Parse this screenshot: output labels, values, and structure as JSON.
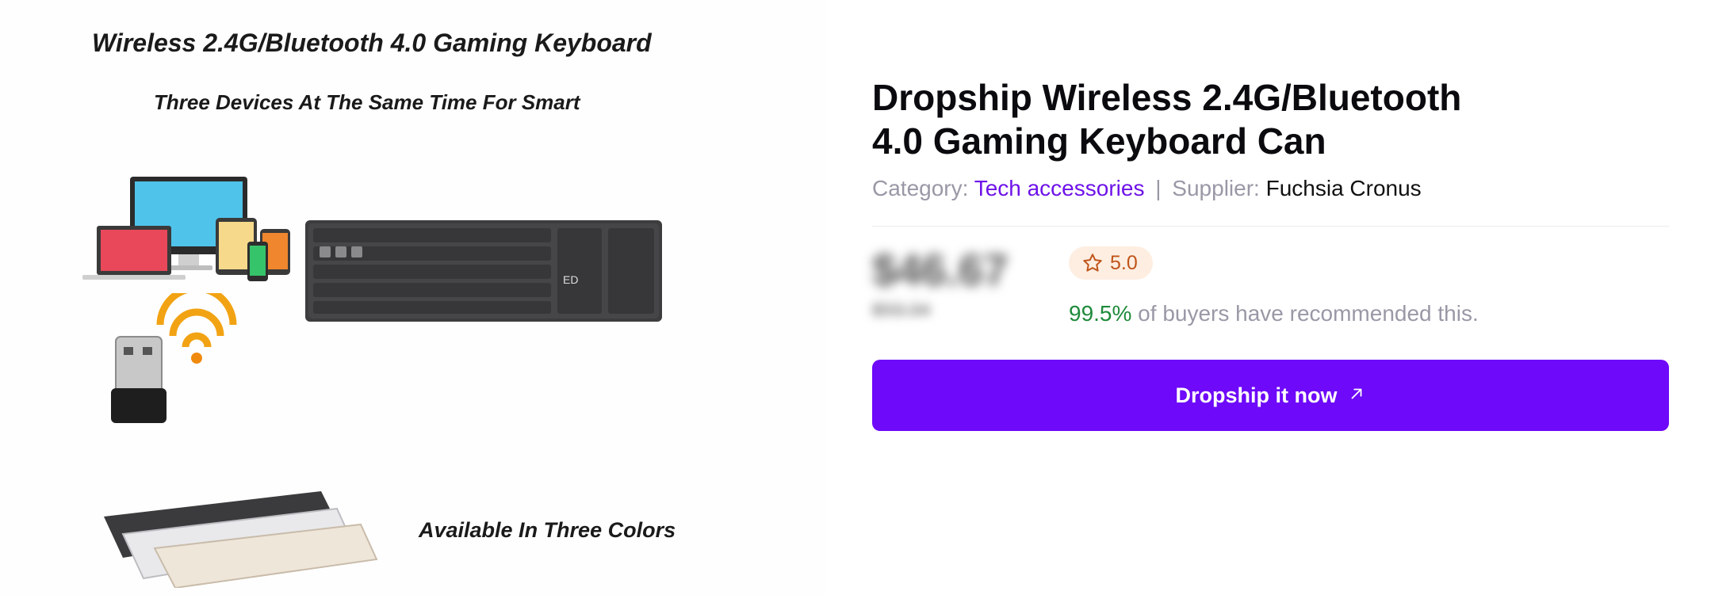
{
  "product_image": {
    "headline": "Wireless 2.4G/Bluetooth 4.0 Gaming Keyboard",
    "subheadline": "Three Devices At The Same Time For Smart",
    "colors_caption": "Available In Three Colors"
  },
  "product": {
    "title": "Dropship Wireless 2.4G/Bluetooth 4.0 Gaming Keyboard Can",
    "category_label": "Category:",
    "category_value": "Tech accessories",
    "separator": "|",
    "supplier_label": "Supplier:",
    "supplier_value": "Fuchsia Cronus",
    "price": "$46.67",
    "old_price": "$93.34",
    "rating": "5.0",
    "recommend_percent": "99.5%",
    "recommend_text": " of buyers have recommended this.",
    "cta_label": "Dropship it now"
  },
  "icons": {
    "rating": "star-outline-icon",
    "cta": "arrow-up-right-icon"
  },
  "colors": {
    "accent": "#6e09f9",
    "category_link": "#6e12e8",
    "rating_bg": "#fdeee1",
    "rating_text": "#c0541a",
    "recommend_percent": "#1f8a3b",
    "muted_text": "#9a98a6"
  }
}
